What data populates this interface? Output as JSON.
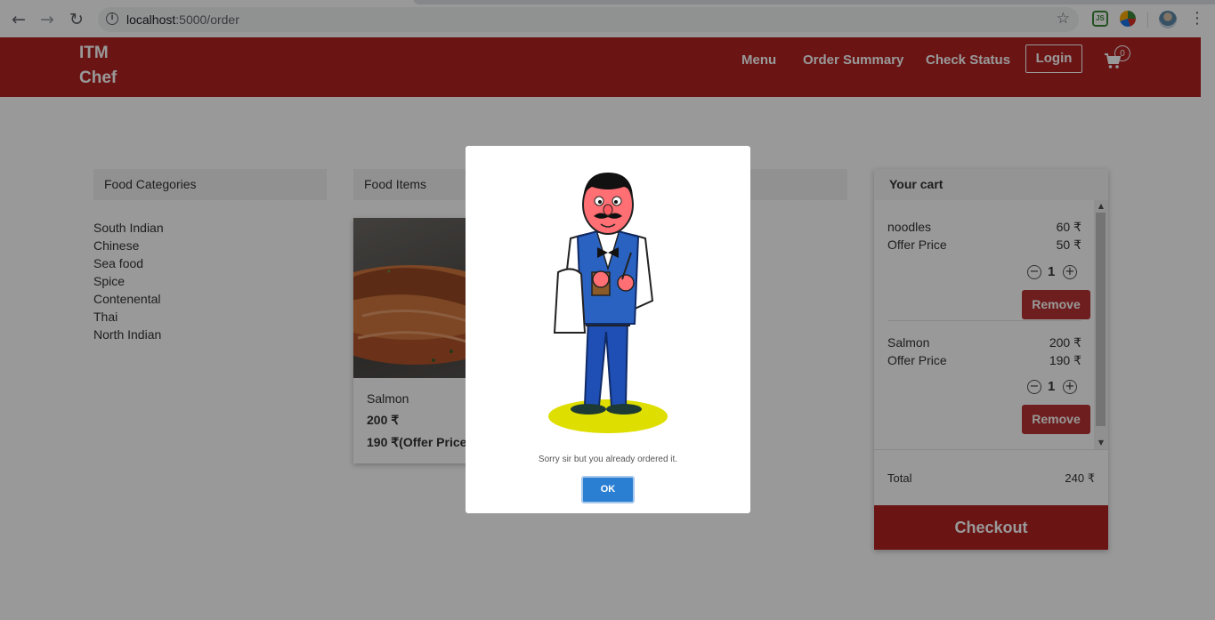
{
  "browser": {
    "url_host": "localhost",
    "url_path": ":5000/order"
  },
  "header": {
    "brand_line1": "ITM",
    "brand_line2": "Chef",
    "nav": [
      "Menu",
      "Order Summary",
      "Check Status"
    ],
    "login_label": "Login",
    "cart_count": "0"
  },
  "categories": {
    "title": "Food Categories",
    "items": [
      "South Indian",
      "Chinese",
      "Sea food",
      "Spice",
      "Contenental",
      "Thai",
      "North Indian"
    ]
  },
  "food_items": {
    "title": "Food Items",
    "cards": [
      {
        "name": "Salmon",
        "price": "200 ₹",
        "offer_price": "190 ₹(Offer Price)"
      }
    ]
  },
  "cart": {
    "title": "Your cart",
    "items": [
      {
        "name": "noodles",
        "price": "60 ₹",
        "offer_label": "Offer Price",
        "offer_price": "50 ₹",
        "qty": "1",
        "remove_label": "Remove"
      },
      {
        "name": "Salmon",
        "price": "200 ₹",
        "offer_label": "Offer Price",
        "offer_price": "190 ₹",
        "qty": "1",
        "remove_label": "Remove"
      }
    ],
    "total_label": "Total",
    "total_value": "240 ₹",
    "checkout_label": "Checkout"
  },
  "modal": {
    "message": "Sorry sir but you already ordered it.",
    "ok_label": "OK"
  },
  "colors": {
    "brand_red": "#b22222",
    "remove_red": "#b83232",
    "ok_blue": "#2b7fd3"
  },
  "icons": [
    "back-icon",
    "forward-icon",
    "reload-icon",
    "info-icon",
    "star-icon",
    "cart-icon",
    "minus-icon",
    "plus-icon",
    "kebab-menu-icon"
  ]
}
